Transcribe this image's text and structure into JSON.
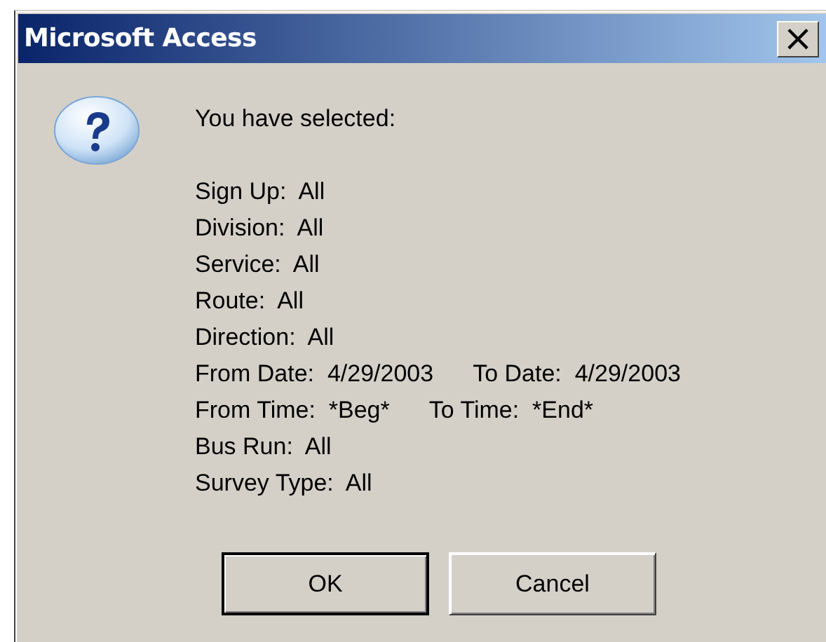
{
  "window": {
    "title": "Microsoft Access",
    "close_glyph": "×"
  },
  "message": {
    "heading": "You have selected:",
    "lines": [
      [
        "Sign Up:  All"
      ],
      [
        "Division:  All"
      ],
      [
        "Service:  All"
      ],
      [
        "Route:  All"
      ],
      [
        "Direction:  All"
      ],
      [
        "From Date:  4/29/2003",
        "To Date:  4/29/2003"
      ],
      [
        "From Time:  *Beg*",
        "To Time:  *End*"
      ],
      [
        "Bus Run:  All"
      ],
      [
        "Survey Type:  All"
      ]
    ]
  },
  "buttons": [
    {
      "label": "OK",
      "default": true
    },
    {
      "label": "Cancel",
      "default": false
    }
  ]
}
